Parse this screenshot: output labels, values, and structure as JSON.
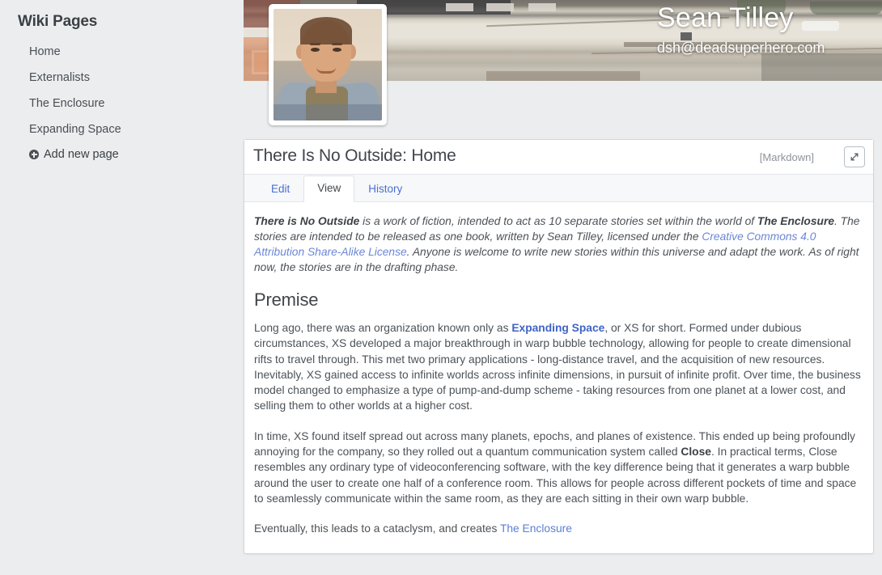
{
  "sidebar": {
    "title": "Wiki Pages",
    "items": [
      {
        "label": "Home"
      },
      {
        "label": "Externalists"
      },
      {
        "label": "The Enclosure"
      },
      {
        "label": "Expanding Space"
      }
    ],
    "add_page_label": "Add new page",
    "add_page_icon": "plus-circle-icon"
  },
  "banner": {
    "name": "Sean Tilley",
    "email": "dsh@deadsuperhero.com",
    "avatar_alt": "Sean Tilley profile photo"
  },
  "card": {
    "title": "There Is No Outside: Home",
    "format_tag": "[Markdown]",
    "expand_icon": "expand-diagonal-icon",
    "tabs": [
      {
        "label": "Edit",
        "active": false
      },
      {
        "label": "View",
        "active": true
      },
      {
        "label": "History",
        "active": false
      }
    ],
    "content": {
      "intro": {
        "b1": "There is No Outside",
        "t1": " is a work of fiction, intended to act as 10 separate stories set within the world of ",
        "b2": "The Enclosure",
        "t2": ". The stories are intended to be released as one book, written by Sean Tilley, licensed under the ",
        "link": "Creative Commons 4.0 Attribution Share-Alike License",
        "t3": ". Anyone is welcome to write new stories within this universe and adapt the work. As of right now, the stories are in the drafting phase."
      },
      "premise_heading": "Premise",
      "para1": {
        "t1": "Long ago, there was an organization known only as ",
        "link": "Expanding Space",
        "t2": ", or XS for short. Formed under dubious circumstances, XS developed a major breakthrough in warp bubble technology, allowing for people to create dimensional rifts to travel through. This met two primary applications - long-distance travel, and the acquisition of new resources. Inevitably, XS gained access to infinite worlds across infinite dimensions, in pursuit of infinite profit. Over time, the business model changed to emphasize a type of pump-and-dump scheme - taking resources from one planet at a lower cost, and selling them to other worlds at a higher cost."
      },
      "para2": {
        "t1": "In time, XS found itself spread out across many planets, epochs, and planes of existence. This ended up being profoundly annoying for the company, so they rolled out a quantum communication system called ",
        "b1": "Close",
        "t2": ". In practical terms, Close resembles any ordinary type of videoconferencing software, with the key difference being that it generates a warp bubble around the user to create one half of a conference room. This allows for people across different pockets of time and space to seamlessly communicate within the same room, as they are each sitting in their own warp bubble."
      },
      "para3": {
        "t1": "Eventually, this leads to a cataclysm, and creates ",
        "link": "The Enclosure"
      }
    }
  },
  "colors": {
    "page_background": "#ebedef",
    "card_background": "#ffffff",
    "link": "#5b7fd4",
    "link_strong": "#3f63c7",
    "text": "#4d5257",
    "heading": "#41464b",
    "muted": "#8d9399"
  }
}
